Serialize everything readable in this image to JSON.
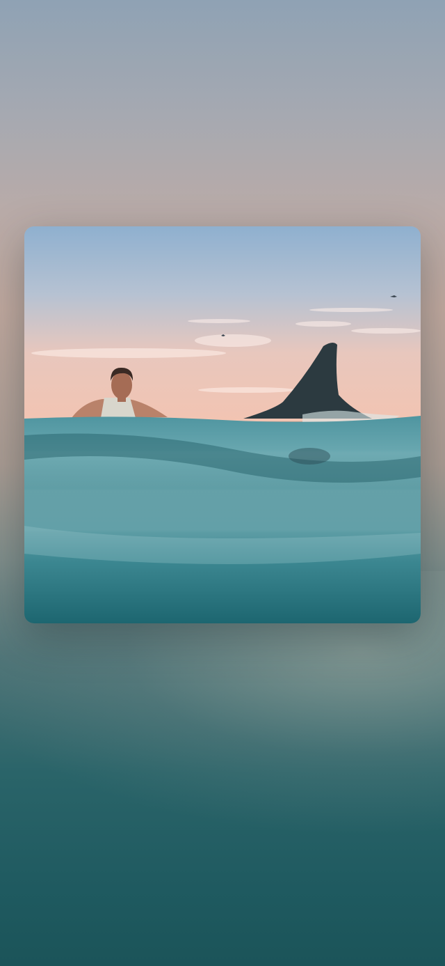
{
  "screen": {
    "type": "wallpaper-preview"
  },
  "photo": {
    "subject_icons": [
      "surfer-figure",
      "shark-fin-shape",
      "bird-silhouette"
    ],
    "colors": {
      "sky_top": "#8fb0cf",
      "sky_horizon": "#f3c9b8",
      "water_surface": "#5c9ca6",
      "water_deep": "#1d6670",
      "fin": "#2c3a40"
    }
  }
}
